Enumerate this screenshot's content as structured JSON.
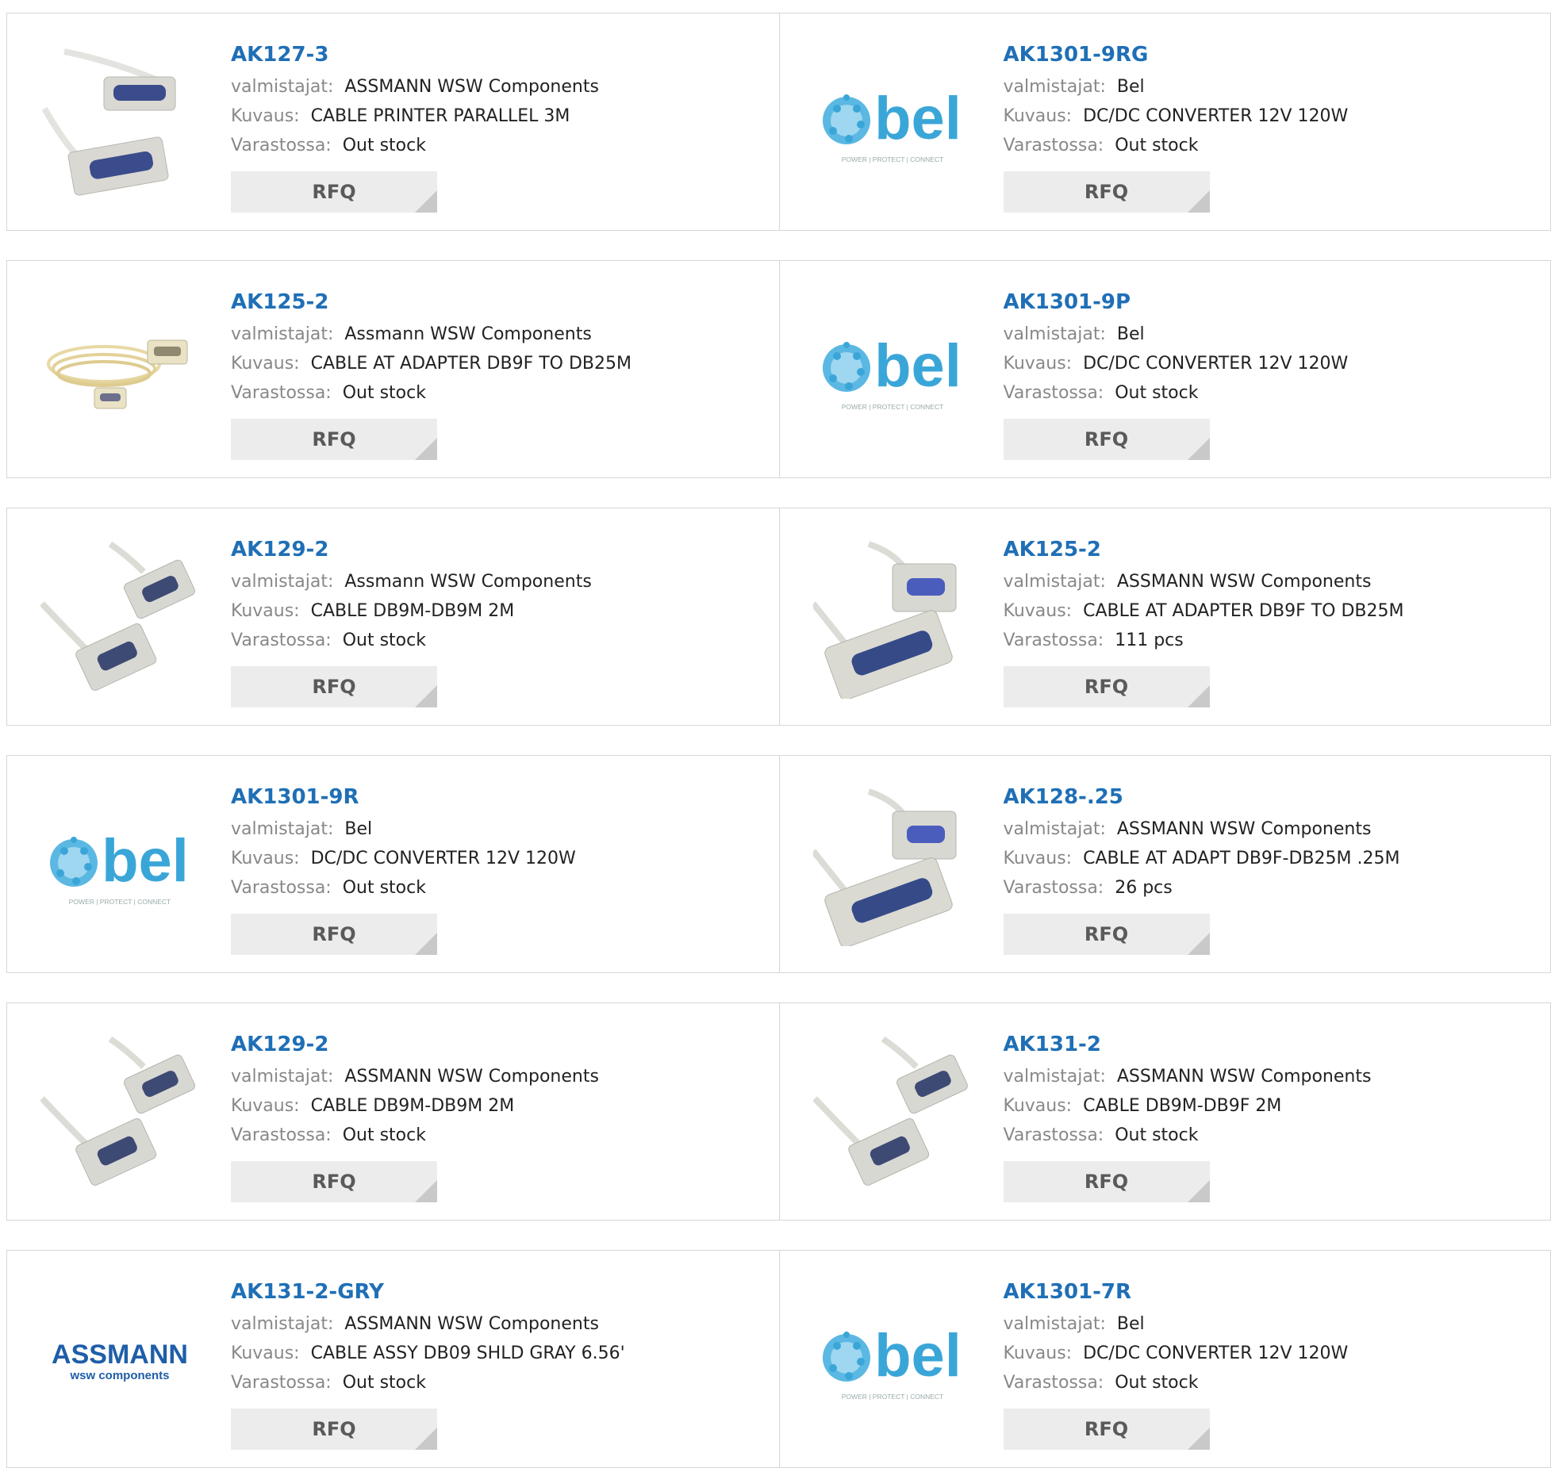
{
  "labels": {
    "manufacturer": "valmistajat:",
    "description": "Kuvaus:",
    "stock": "Varastossa:",
    "rfq": "RFQ"
  },
  "products": [
    {
      "pn": "AK127-3",
      "manufacturer": "ASSMANN WSW Components",
      "description": "CABLE PRINTER PARALLEL 3M",
      "stock": "Out stock",
      "image": "parallel-printer-cable-icon"
    },
    {
      "pn": "AK1301-9RG",
      "manufacturer": "Bel",
      "description": "DC/DC CONVERTER 12V 120W",
      "stock": "Out stock",
      "image": "bel-logo",
      "logo_text": "bel",
      "logo_tagline": "POWER | PROTECT | CONNECT"
    },
    {
      "pn": "AK125-2",
      "manufacturer": "Assmann WSW Components",
      "description": "CABLE AT ADAPTER DB9F TO DB25M",
      "stock": "Out stock",
      "image": "coiled-adapter-cable-icon"
    },
    {
      "pn": "AK1301-9P",
      "manufacturer": "Bel",
      "description": "DC/DC CONVERTER 12V 120W",
      "stock": "Out stock",
      "image": "bel-logo",
      "logo_text": "bel",
      "logo_tagline": "POWER | PROTECT | CONNECT"
    },
    {
      "pn": "AK129-2",
      "manufacturer": "Assmann WSW Components",
      "description": "CABLE DB9M-DB9M 2M",
      "stock": "Out stock",
      "image": "db9-cable-icon"
    },
    {
      "pn": "AK125-2",
      "manufacturer": "ASSMANN WSW Components",
      "description": "CABLE AT ADAPTER DB9F TO DB25M",
      "stock": "111 pcs",
      "image": "db9-db25-cable-icon"
    },
    {
      "pn": "AK1301-9R",
      "manufacturer": "Bel",
      "description": "DC/DC CONVERTER 12V 120W",
      "stock": "Out stock",
      "image": "bel-logo",
      "logo_text": "bel",
      "logo_tagline": "POWER | PROTECT | CONNECT"
    },
    {
      "pn": "AK128-.25",
      "manufacturer": "ASSMANN WSW Components",
      "description": "CABLE AT ADAPT DB9F-DB25M .25M",
      "stock": "26 pcs",
      "image": "db9-db25-cable-icon"
    },
    {
      "pn": "AK129-2",
      "manufacturer": "ASSMANN WSW Components",
      "description": "CABLE DB9M-DB9M 2M",
      "stock": "Out stock",
      "image": "db9-cable-icon"
    },
    {
      "pn": "AK131-2",
      "manufacturer": "ASSMANN WSW Components",
      "description": "CABLE DB9M-DB9F 2M",
      "stock": "Out stock",
      "image": "db9-cable-icon"
    },
    {
      "pn": "AK131-2-GRY",
      "manufacturer": "ASSMANN WSW Components",
      "description": "CABLE ASSY DB09 SHLD GRAY 6.56'",
      "stock": "Out stock",
      "image": "assmann-logo",
      "logo_text": "ASSMANN",
      "logo_tagline": "wsw components"
    },
    {
      "pn": "AK1301-7R",
      "manufacturer": "Bel",
      "description": "DC/DC CONVERTER 12V 120W",
      "stock": "Out stock",
      "image": "bel-logo",
      "logo_text": "bel",
      "logo_tagline": "POWER | PROTECT | CONNECT"
    }
  ],
  "colors": {
    "link": "#1f6fb6",
    "label": "#888888",
    "border": "#d6d6d6",
    "button_bg": "#ececec",
    "bel_blue": "#3aa6d8"
  }
}
